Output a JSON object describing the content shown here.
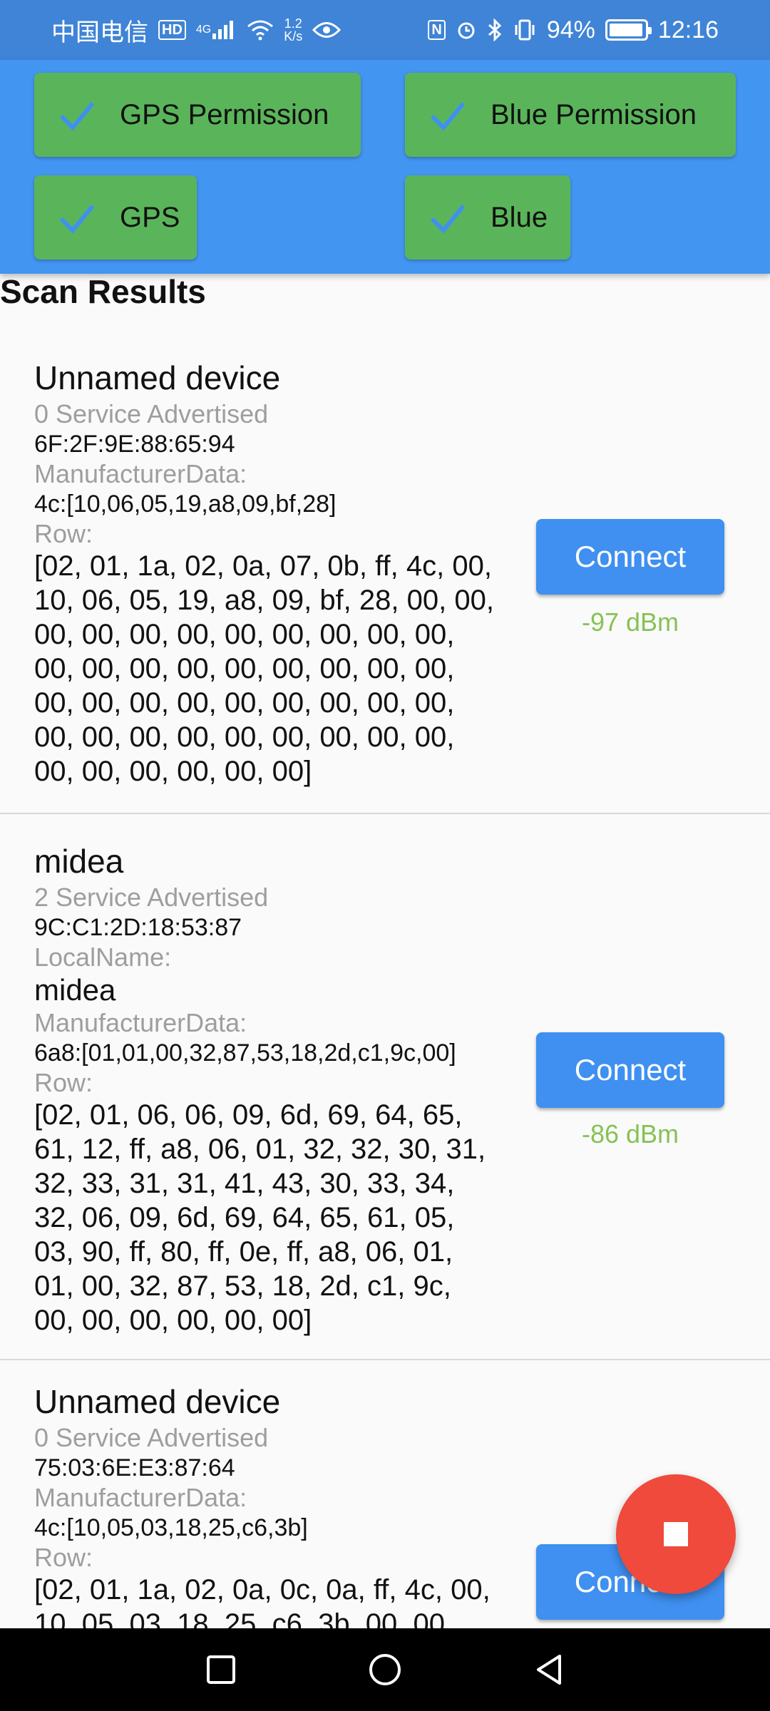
{
  "status_bar": {
    "carrier": "中国电信",
    "hd": "HD",
    "net": "4G",
    "speed_value": "1.2",
    "speed_unit": "K/s",
    "nfc": "N",
    "battery": "94%",
    "time": "12:16"
  },
  "header": {
    "chips": [
      {
        "label": "GPS Permission"
      },
      {
        "label": "Blue Permission"
      },
      {
        "label": "GPS"
      },
      {
        "label": "Blue"
      }
    ]
  },
  "section_title": "Scan Results",
  "devices": [
    {
      "name": "Unnamed device",
      "services": "0 Service Advertised",
      "address": "6F:2F:9E:88:65:94",
      "manufacturer_label": "ManufacturerData:",
      "manufacturer": "4c:[10,06,05,19,a8,09,bf,28]",
      "row_label": "Row:",
      "row": "[02, 01, 1a, 02, 0a, 07, 0b, ff, 4c, 00,\n10, 06, 05, 19, a8, 09, bf, 28, 00, 00,\n00, 00, 00, 00, 00, 00, 00, 00, 00,\n00, 00, 00, 00, 00, 00, 00, 00, 00,\n00, 00, 00, 00, 00, 00, 00, 00, 00,\n00, 00, 00, 00, 00, 00, 00, 00, 00,\n00, 00, 00, 00, 00, 00]",
      "connect": "Connect",
      "rssi": "-97 dBm"
    },
    {
      "name": "midea",
      "services": "2 Service Advertised",
      "address": "9C:C1:2D:18:53:87",
      "localname_label": "LocalName:",
      "localname": "midea",
      "manufacturer_label": "ManufacturerData:",
      "manufacturer": "6a8:[01,01,00,32,87,53,18,2d,c1,9c,00]",
      "row_label": "Row:",
      "row": "[02, 01, 06, 06, 09, 6d, 69, 64, 65,\n61, 12, ff, a8, 06, 01, 32, 32, 30, 31,\n32, 33, 31, 31, 41, 43, 30, 33, 34,\n32, 06, 09, 6d, 69, 64, 65, 61, 05,\n03, 90, ff, 80, ff, 0e, ff, a8, 06, 01,\n01, 00, 32, 87, 53, 18, 2d, c1, 9c,\n00, 00, 00, 00, 00, 00]",
      "connect": "Connect",
      "rssi": "-86 dBm"
    },
    {
      "name": "Unnamed device",
      "services": "0 Service Advertised",
      "address": "75:03:6E:E3:87:64",
      "manufacturer_label": "ManufacturerData:",
      "manufacturer": "4c:[10,05,03,18,25,c6,3b]",
      "row_label": "Row:",
      "row": "[02, 01, 1a, 02, 0a, 0c, 0a, ff, 4c, 00,\n10, 05, 03, 18, 25, c6, 3b, 00, 00,",
      "connect": "Connect"
    }
  ],
  "colors": {
    "app_bar": "#4295f0",
    "chip": "#5ab55a",
    "button": "#3f90f0",
    "rssi": "#86c255",
    "fab": "#ef4a3c"
  },
  "icons": {
    "chip_check": "check-icon",
    "fab": "stop-icon",
    "nav": [
      "recents-square-icon",
      "home-circle-icon",
      "back-triangle-icon"
    ]
  }
}
